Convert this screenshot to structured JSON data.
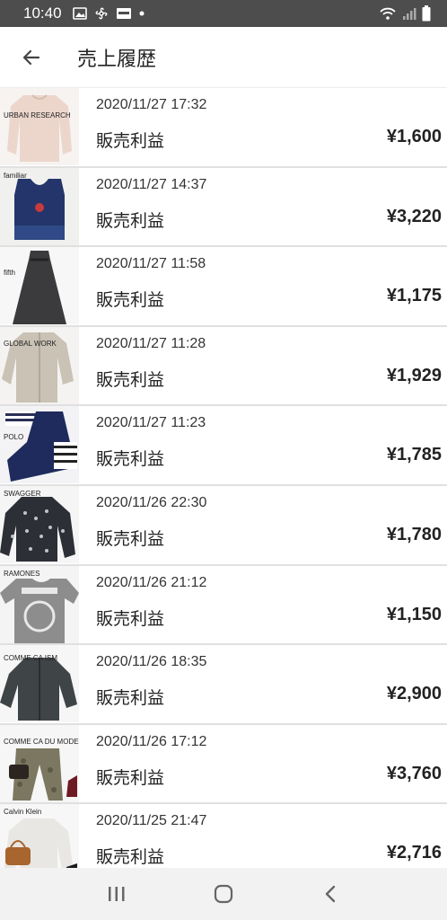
{
  "status_bar": {
    "time": "10:40"
  },
  "header": {
    "title": "売上履歴"
  },
  "icons": {
    "back": "back-arrow-icon",
    "recents": "recent-apps-icon",
    "home": "home-icon",
    "nav_back": "nav-back-icon"
  },
  "colors": {
    "status_bar_bg": "#4d4d4d",
    "divider": "#e0e0e0",
    "nav_bg": "#f2f2f2"
  },
  "items": [
    {
      "brand": "URBAN RESEARCH",
      "date": "2020/11/27 17:32",
      "type": "販売利益",
      "amount": "¥1,600"
    },
    {
      "brand": "familiar",
      "date": "2020/11/27 14:37",
      "type": "販売利益",
      "amount": "¥3,220"
    },
    {
      "brand": "fifth",
      "date": "2020/11/27 11:58",
      "type": "販売利益",
      "amount": "¥1,175"
    },
    {
      "brand": "GLOBAL WORK",
      "date": "2020/11/27 11:28",
      "type": "販売利益",
      "amount": "¥1,929"
    },
    {
      "brand": "POLO",
      "date": "2020/11/27 11:23",
      "type": "販売利益",
      "amount": "¥1,785"
    },
    {
      "brand": "SWAGGER",
      "date": "2020/11/26 22:30",
      "type": "販売利益",
      "amount": "¥1,780"
    },
    {
      "brand": "RAMONES",
      "date": "2020/11/26 21:12",
      "type": "販売利益",
      "amount": "¥1,150"
    },
    {
      "brand": "COMME CA ISM",
      "date": "2020/11/26 18:35",
      "type": "販売利益",
      "amount": "¥2,900"
    },
    {
      "brand": "COMME CA DU MODE",
      "date": "2020/11/26 17:12",
      "type": "販売利益",
      "amount": "¥3,760"
    },
    {
      "brand": "Calvin Klein",
      "date": "2020/11/25 21:47",
      "type": "販売利益",
      "amount": "¥2,716"
    }
  ]
}
